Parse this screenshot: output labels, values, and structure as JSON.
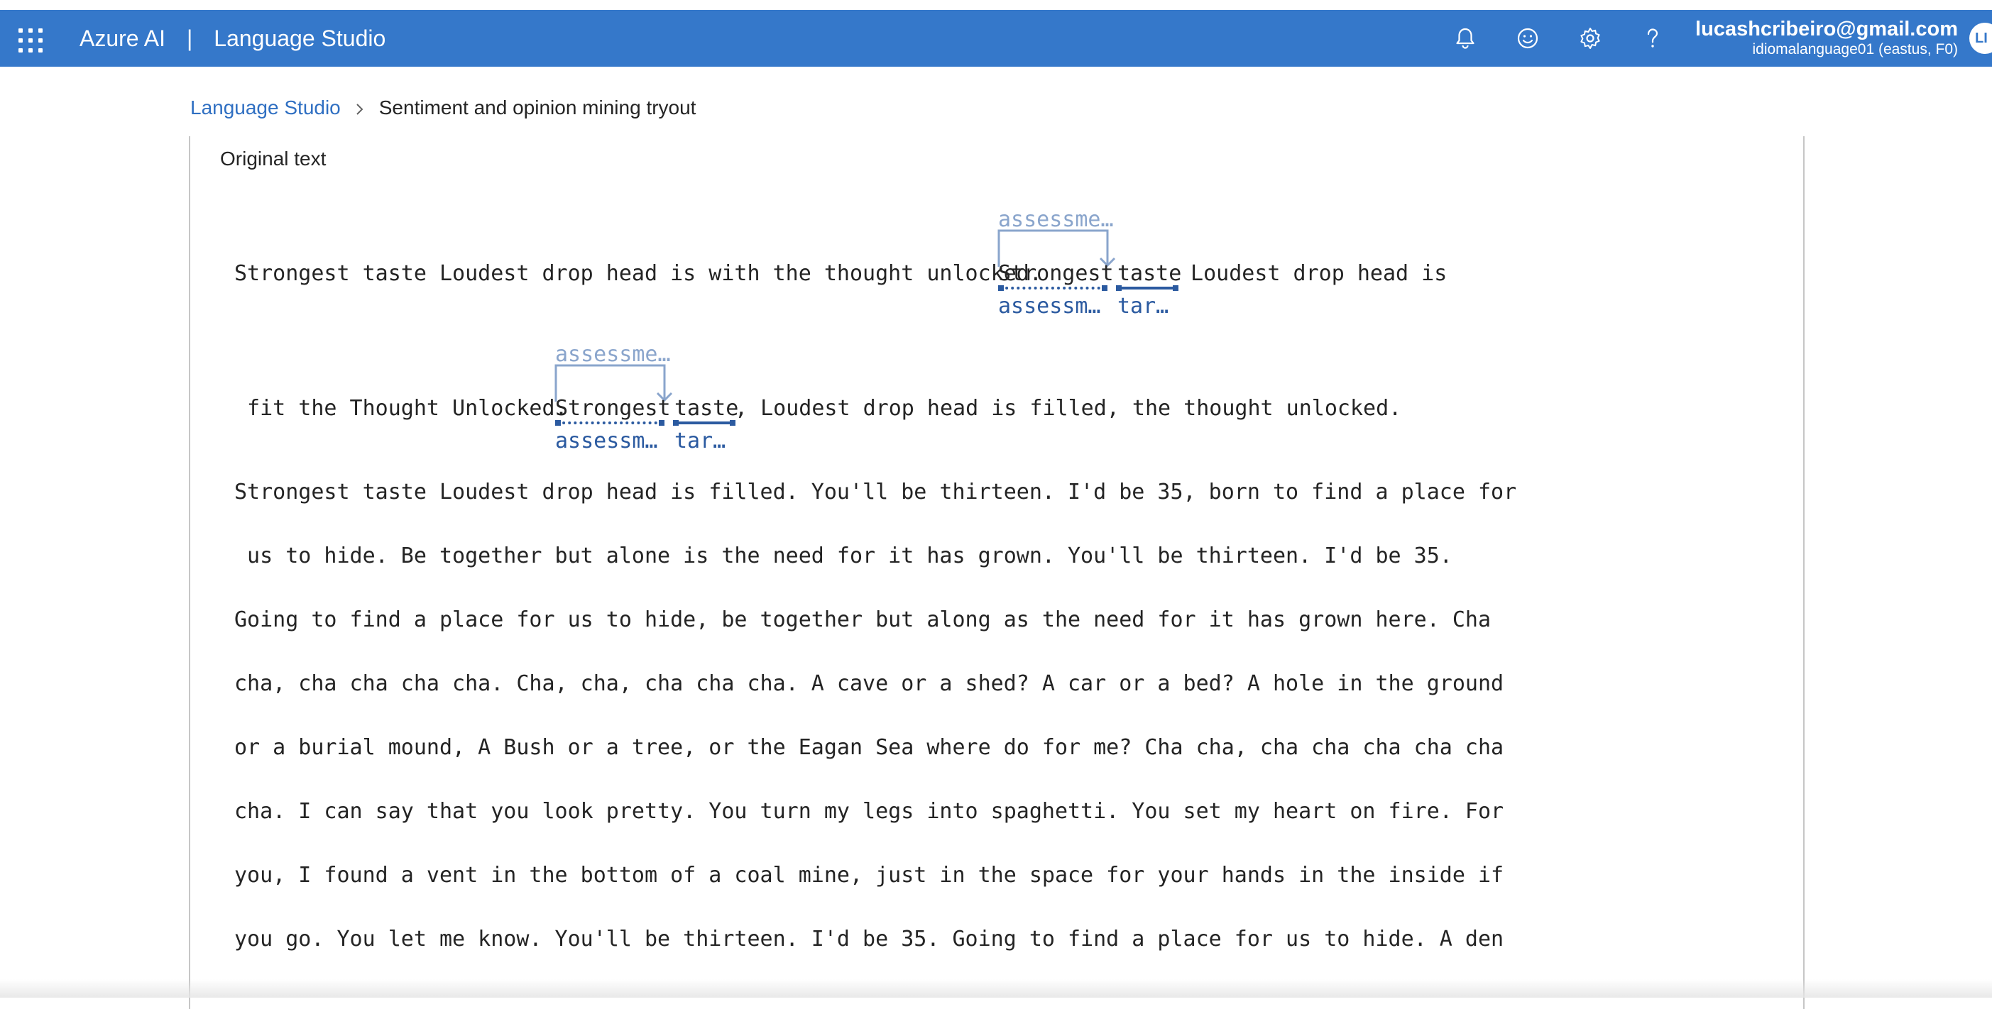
{
  "topbar": {
    "app_name": "Azure AI",
    "separator": "|",
    "product": "Language Studio",
    "icons": [
      "bell-icon",
      "smiley-icon",
      "gear-icon",
      "help-icon"
    ],
    "account": {
      "email": "lucashcribeiro@gmail.com",
      "resource": "idiomalanguage01 (eastus, F0)",
      "avatar_initials": "LI"
    }
  },
  "breadcrumb": {
    "root": "Language Studio",
    "current": "Sentiment and opinion mining tryout"
  },
  "panel": {
    "title": "Original text",
    "line1": "Strongest taste Loudest drop head is with the thought unlocked. ",
    "line1_token_a": "Strongest",
    "line1_space": " ",
    "line1_token_b": "taste",
    "line1_rest": " Loudest drop head is",
    "line1_ann_top": "assessme…",
    "line1_ann_a": "assessm…",
    "line1_ann_b": "tar…",
    "line2_lead": " fit the Thought Unlocked. ",
    "line2_token_a": "Strongest",
    "line2_token_b": "taste",
    "line2_rest": ", Loudest drop head is filled, the thought unlocked.",
    "line2_ann_top": "assessme…",
    "line2_ann_a": "assessm…",
    "line2_ann_b": "tar…",
    "lines": [
      "Strongest taste Loudest drop head is filled. You'll be thirteen. I'd be 35, born to find a place for",
      " us to hide. Be together but alone is the need for it has grown. You'll be thirteen. I'd be 35.",
      "Going to find a place for us to hide, be together but along as the need for it has grown here. Cha",
      "cha, cha cha cha cha. Cha, cha, cha cha cha. A cave or a shed? A car or a bed? A hole in the ground",
      "or a burial mound, A Bush or a tree, or the Eagan Sea where do for me? Cha cha, cha cha cha cha cha",
      "cha. I can say that you look pretty. You turn my legs into spaghetti. You set my heart on fire. For",
      "you, I found a vent in the bottom of a coal mine, just in the space for your hands in the inside if",
      "you go. You let me know. You'll be thirteen. I'd be 35. Going to find a place for us to hide. A den"
    ]
  }
}
